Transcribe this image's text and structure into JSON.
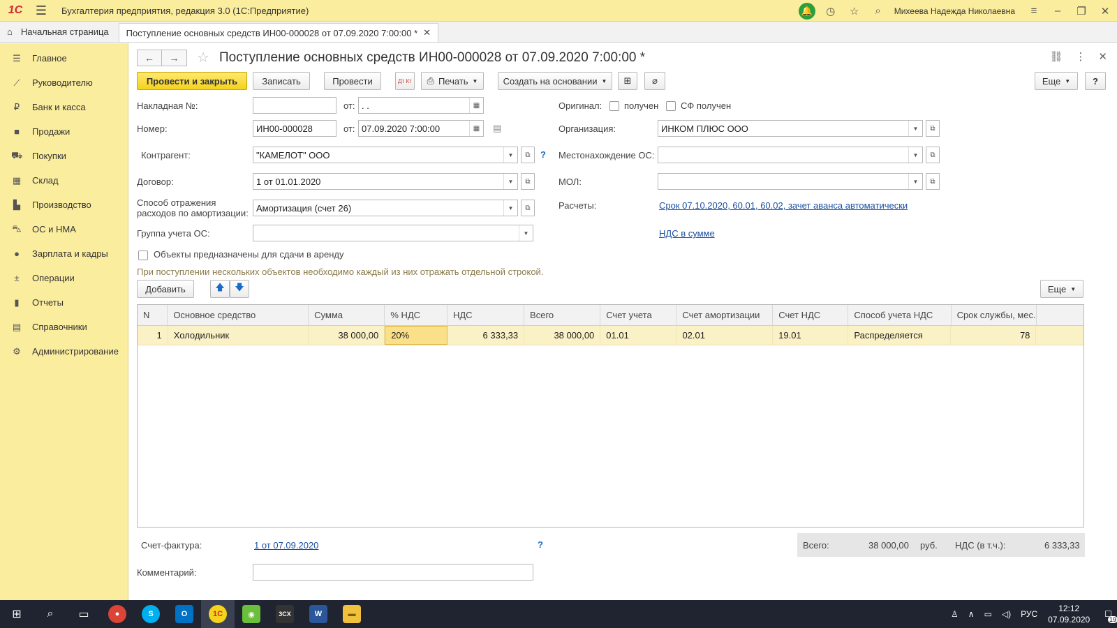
{
  "titlebar": {
    "logo": "1С",
    "app_title": "Бухгалтерия предприятия, редакция 3.0  (1С:Предприятие)",
    "user": "Михеева Надежда Николаевна"
  },
  "tabs": {
    "home": "Начальная страница",
    "doc": "Поступление основных средств ИН00-000028 от 07.09.2020 7:00:00 *"
  },
  "sidebar": {
    "items": [
      {
        "label": "Главное"
      },
      {
        "label": "Руководителю"
      },
      {
        "label": "Банк и касса"
      },
      {
        "label": "Продажи"
      },
      {
        "label": "Покупки"
      },
      {
        "label": "Склад"
      },
      {
        "label": "Производство"
      },
      {
        "label": "ОС и НМА"
      },
      {
        "label": "Зарплата и кадры"
      },
      {
        "label": "Операции"
      },
      {
        "label": "Отчеты"
      },
      {
        "label": "Справочники"
      },
      {
        "label": "Администрирование"
      }
    ]
  },
  "doc": {
    "title": "Поступление основных средств ИН00-000028 от 07.09.2020 7:00:00 *"
  },
  "toolbar": {
    "post_close": "Провести и закрыть",
    "save": "Записать",
    "post": "Провести",
    "dtkt": "Дт Кт",
    "print": "Печать",
    "create_based": "Создать на основании",
    "more": "Еще",
    "help": "?"
  },
  "form": {
    "invoice_no_label": "Накладная №:",
    "invoice_no_value": "",
    "from_label": "от:",
    "invoice_date_value": " .  .",
    "number_label": "Номер:",
    "number_value": "ИН00-000028",
    "number_date_value": "07.09.2020  7:00:00",
    "contractor_label": "Контрагент:",
    "contractor_value": "\"КАМЕЛОТ\" ООО",
    "contract_label": "Договор:",
    "contract_value": "1 от 01.01.2020",
    "amort_label_1": "Способ отражения",
    "amort_label_2": "расходов по амортизации:",
    "amort_value": "Амортизация (счет 26)",
    "group_label": "Группа учета ОС:",
    "group_value": "",
    "rent_label": "Объекты предназначены для сдачи в аренду",
    "original_label": "Оригинал:",
    "received_label": "получен",
    "sf_received_label": "СФ получен",
    "org_label": "Организация:",
    "org_value": "ИНКОМ ПЛЮС ООО",
    "location_label": "Местонахождение ОС:",
    "location_value": "",
    "mol_label": "МОЛ:",
    "mol_value": "",
    "settlements_label": "Расчеты:",
    "settlements_link": "Срок 07.10.2020, 60.01, 60.02, зачет аванса автоматически",
    "vat_link": "НДС в сумме",
    "hint": "При поступлении нескольких объектов необходимо каждый из них отражать отдельной строкой."
  },
  "table_toolbar": {
    "add": "Добавить",
    "more": "Еще"
  },
  "table": {
    "columns": [
      "N",
      "Основное средство",
      "Сумма",
      "% НДС",
      "НДС",
      "Всего",
      "Счет учета",
      "Счет амортизации",
      "Счет НДС",
      "Способ учета НДС",
      "Срок службы, мес."
    ],
    "rows": [
      [
        "1",
        "Холодильник",
        "38 000,00",
        "20%",
        "6 333,33",
        "38 000,00",
        "01.01",
        "02.01",
        "19.01",
        "Распределяется",
        "78"
      ]
    ]
  },
  "footer": {
    "invoice_label": "Счет-фактура:",
    "invoice_link": "1 от 07.09.2020",
    "comment_label": "Комментарий:",
    "comment_value": "",
    "total_label": "Всего:",
    "total_value": "38 000,00",
    "currency": "руб.",
    "vat_label": "НДС (в т.ч.):",
    "vat_value": "6 333,33"
  },
  "taskbar": {
    "lang": "РУС",
    "time": "12:12",
    "date": "07.09.2020",
    "notif_count": "19"
  }
}
